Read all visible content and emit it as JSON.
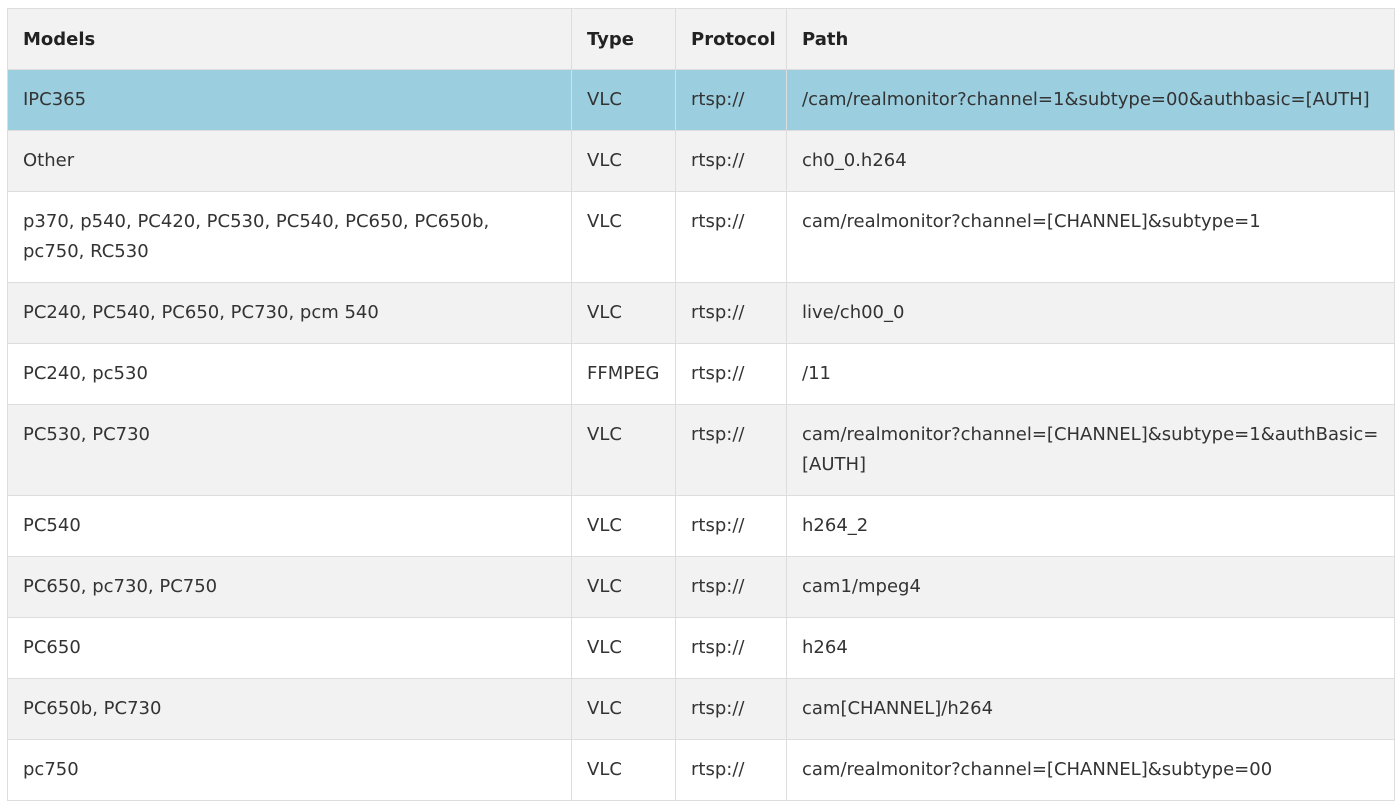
{
  "table": {
    "headers": [
      "Models",
      "Type",
      "Protocol",
      "Path"
    ],
    "rows": [
      {
        "model": "IPC365",
        "type": "VLC",
        "protocol": "rtsp://",
        "path": "/cam/realmonitor?channel=1&subtype=00&authbasic=[AUTH]",
        "selected": true
      },
      {
        "model": "Other",
        "type": "VLC",
        "protocol": "rtsp://",
        "path": "ch0_0.h264"
      },
      {
        "model": "p370, p540, PC420, PC530, PC540, PC650, PC650b, pc750, RC530",
        "type": "VLC",
        "protocol": "rtsp://",
        "path": "cam/realmonitor?channel=[CHANNEL]&subtype=1"
      },
      {
        "model": "PC240, PC540, PC650, PC730, pcm 540",
        "type": "VLC",
        "protocol": "rtsp://",
        "path": "live/ch00_0"
      },
      {
        "model": "PC240, pc530",
        "type": "FFMPEG",
        "protocol": "rtsp://",
        "path": "/11"
      },
      {
        "model": "PC530, PC730",
        "type": "VLC",
        "protocol": "rtsp://",
        "path": "cam/realmonitor?channel=[CHANNEL]&subtype=1&authBasic=[AUTH]"
      },
      {
        "model": "PC540",
        "type": "VLC",
        "protocol": "rtsp://",
        "path": "h264_2"
      },
      {
        "model": "PC650, pc730, PC750",
        "type": "VLC",
        "protocol": "rtsp://",
        "path": "cam1/mpeg4"
      },
      {
        "model": "PC650",
        "type": "VLC",
        "protocol": "rtsp://",
        "path": "h264"
      },
      {
        "model": "PC650b, PC730",
        "type": "VLC",
        "protocol": "rtsp://",
        "path": "cam[CHANNEL]/h264"
      },
      {
        "model": "pc750",
        "type": "VLC",
        "protocol": "rtsp://",
        "path": "cam/realmonitor?channel=[CHANNEL]&subtype=00"
      }
    ]
  },
  "colors": {
    "selected_row": "#9bcfe0",
    "stripe": "#f2f2f2",
    "border": "#dddddd"
  }
}
